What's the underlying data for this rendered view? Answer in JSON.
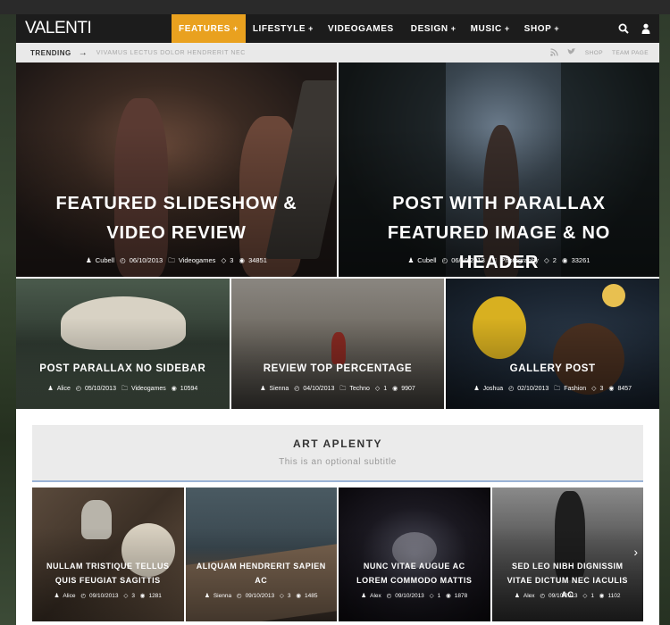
{
  "brand": {
    "logo": "VALENTI",
    "accent": "#e9a11f"
  },
  "nav": {
    "items": [
      {
        "label": "FEATURES",
        "plus": "+",
        "active": true
      },
      {
        "label": "LIFESTYLE",
        "plus": "+"
      },
      {
        "label": "VIDEOGAMES",
        "plus": ""
      },
      {
        "label": "DESIGN",
        "plus": "+"
      },
      {
        "label": "MUSIC",
        "plus": "+"
      },
      {
        "label": "SHOP",
        "plus": "+"
      }
    ],
    "icons": [
      "search-icon",
      "user-icon"
    ]
  },
  "trending": {
    "label": "TRENDING",
    "arrow": "→",
    "text": "VIVAMUS LECTUS DOLOR HENDRERIT NEC",
    "links": [
      "SHOP",
      "TEAM PAGE"
    ],
    "icons": [
      "rss-icon",
      "twitter-icon"
    ]
  },
  "hero": [
    {
      "title": "FEATURED SLIDESHOW & VIDEO REVIEW",
      "author": "Cubell",
      "date": "06/10/2013",
      "category": "Videogames",
      "comments": "3",
      "views": "34851"
    },
    {
      "title": "POST WITH PARALLAX FEATURED IMAGE & NO HEADER",
      "author": "Cubell",
      "date": "06/10/2013",
      "category": "Photography",
      "comments": "2",
      "views": "33261"
    }
  ],
  "row2": [
    {
      "title": "POST PARALLAX NO SIDEBAR",
      "author": "Alice",
      "date": "05/10/2013",
      "category": "Videogames",
      "comments": "",
      "views": "10594"
    },
    {
      "title": "REVIEW TOP PERCENTAGE",
      "author": "Sienna",
      "date": "04/10/2013",
      "category": "Techno",
      "comments": "1",
      "views": "9907"
    },
    {
      "title": "GALLERY POST",
      "author": "Joshua",
      "date": "02/10/2013",
      "category": "Fashion",
      "comments": "3",
      "views": "8457"
    }
  ],
  "section": {
    "title": "ART APLENTY",
    "subtitle": "This is an optional subtitle"
  },
  "row3": [
    {
      "title": "NULLAM TRISTIQUE TELLUS QUIS FEUGIAT SAGITTIS",
      "author": "Alice",
      "date": "09/10/2013",
      "comments": "3",
      "views": "1281"
    },
    {
      "title": "ALIQUAM HENDRERIT SAPIEN AC",
      "author": "Sienna",
      "date": "09/10/2013",
      "comments": "3",
      "views": "1485"
    },
    {
      "title": "NUNC VITAE AUGUE AC LOREM COMMODO MATTIS",
      "author": "Alex",
      "date": "09/10/2013",
      "comments": "1",
      "views": "1878"
    },
    {
      "title": "SED LEO NIBH DIGNISSIM VITAE DICTUM NEC IACULIS AC",
      "author": "Alex",
      "date": "09/10/2013",
      "comments": "1",
      "views": "1102"
    }
  ]
}
